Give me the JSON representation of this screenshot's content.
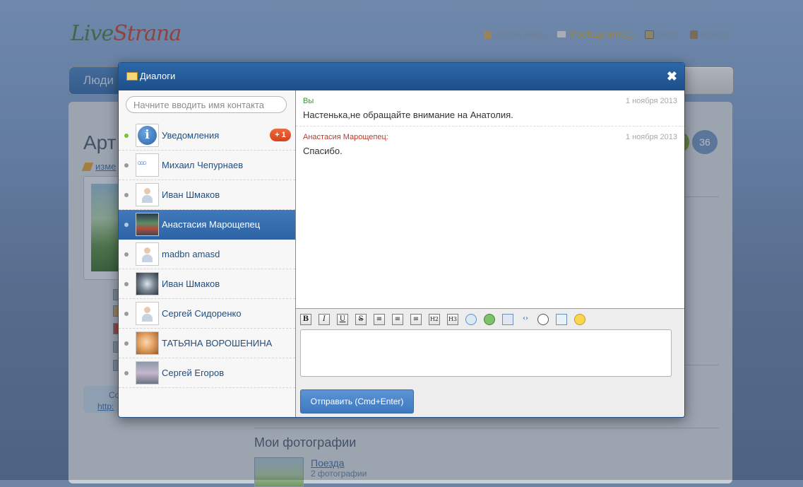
{
  "site": {
    "logo_part1": "Live",
    "logo_part2": "Strana",
    "nav": [
      {
        "label": "Артём Лион",
        "icon": "user-icon"
      },
      {
        "label": "Сообщения (1)",
        "icon": "mail-icon"
      },
      {
        "label": "Фото",
        "icon": "photo-icon"
      },
      {
        "label": "Выход",
        "icon": "exit-icon"
      }
    ],
    "menu_first": "Люди",
    "page_title": "Арт",
    "edit_link": "изме",
    "side_link_text": "Со",
    "side_link_url": "http:",
    "badge_count": "36",
    "photos_title": "Мои фотографии",
    "album_name": "Поезда",
    "album_count": "2 фотографии"
  },
  "dialog": {
    "title": "Диалоги",
    "close": "✖",
    "search_placeholder": "Начните вводить имя контакта",
    "contacts": [
      {
        "name": "Уведомления",
        "online": true,
        "badge": "+ 1",
        "avatar": "info-icon"
      },
      {
        "name": "Михаил Чепурнаев",
        "online": false,
        "avatar": "olympic-rings"
      },
      {
        "name": "Иван Шмаков",
        "online": false,
        "avatar": "default-person"
      },
      {
        "name": "Анастасия Марощепец",
        "online": false,
        "avatar": "photo",
        "selected": true
      },
      {
        "name": "madbn amasd",
        "online": false,
        "avatar": "default-person"
      },
      {
        "name": "Иван Шмаков",
        "online": false,
        "avatar": "photo"
      },
      {
        "name": "Сергей Сидоренко",
        "online": false,
        "avatar": "default-person"
      },
      {
        "name": "ТАТЬЯНА ВОРОШЕНИНА",
        "online": false,
        "avatar": "photo"
      },
      {
        "name": "Сергей Егоров",
        "online": false,
        "avatar": "photo"
      }
    ],
    "messages": [
      {
        "author": "Вы",
        "author_color": "#2e9a2e",
        "date": "1 ноября 2013",
        "text": "Настенька,не обращайте внимание на Анатолия."
      },
      {
        "author": "Анастасия Марощепец:",
        "author_color": "#c0392b",
        "date": "1 ноября 2013",
        "text": "Спасибо."
      }
    ],
    "toolbar": [
      {
        "label": "B",
        "name": "bold-button"
      },
      {
        "label": "I",
        "name": "italic-button"
      },
      {
        "label": "U",
        "name": "underline-button"
      },
      {
        "label": "S",
        "name": "strikethrough-button"
      },
      {
        "label": "≡",
        "name": "align-left-button"
      },
      {
        "label": "≡",
        "name": "align-center-button"
      },
      {
        "label": "≡",
        "name": "align-right-button"
      },
      {
        "label": "H2",
        "name": "h2-button"
      },
      {
        "label": "H3",
        "name": "h3-button"
      },
      {
        "label": "",
        "name": "quote-icon"
      },
      {
        "label": "",
        "name": "link-icon"
      },
      {
        "label": "",
        "name": "email-icon"
      },
      {
        "label": "‹›",
        "name": "code-icon"
      },
      {
        "label": "",
        "name": "preview-icon"
      },
      {
        "label": "",
        "name": "image-icon"
      },
      {
        "label": "",
        "name": "smiley-icon"
      }
    ],
    "editor_value": "",
    "send_label": "Отправить (Cmd+Enter)"
  },
  "colors": {
    "header_blue": "#2d67a8",
    "selected_row": "#3f78bb",
    "online_dot": "#7ec230",
    "badge_orange": "#e2552b"
  }
}
